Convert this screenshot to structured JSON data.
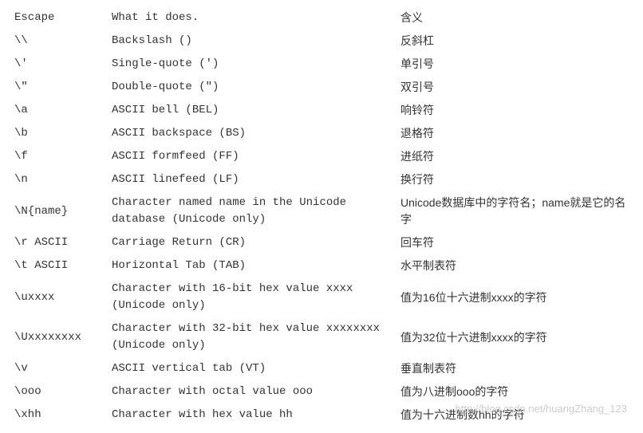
{
  "header": {
    "escape": "Escape",
    "desc": "What it does.",
    "cn": "含义"
  },
  "rows": [
    {
      "escape": "\\\\",
      "desc": "Backslash ()",
      "cn": "反斜杠"
    },
    {
      "escape": "\\'",
      "desc": "Single-quote (')",
      "cn": "单引号"
    },
    {
      "escape": "\\\"",
      "desc": "Double-quote (\")",
      "cn": "双引号"
    },
    {
      "escape": "\\a",
      "desc": "ASCII bell (BEL)",
      "cn": "响铃符"
    },
    {
      "escape": "\\b",
      "desc": "ASCII backspace (BS)",
      "cn": "退格符"
    },
    {
      "escape": "\\f",
      "desc": "ASCII formfeed (FF)",
      "cn": "进纸符"
    },
    {
      "escape": "\\n",
      "desc": "ASCII linefeed (LF)",
      "cn": "换行符"
    },
    {
      "escape": "\\N{name}",
      "desc": "Character named name in the Unicode database (Unicode only)",
      "cn": "Unicode数据库中的字符名；name就是它的名字"
    },
    {
      "escape": "\\r ASCII",
      "desc": "Carriage Return (CR)",
      "cn": "回车符"
    },
    {
      "escape": "\\t ASCII",
      "desc": "Horizontal Tab (TAB)",
      "cn": "水平制表符"
    },
    {
      "escape": "\\uxxxx",
      "desc": "Character with 16-bit hex value xxxx (Unicode only)",
      "cn": "值为16位十六进制xxxx的字符"
    },
    {
      "escape": "\\Uxxxxxxxx",
      "desc": "Character with 32-bit hex value xxxxxxxx (Unicode only)",
      "cn": "值为32位十六进制xxxx的字符"
    },
    {
      "escape": "\\v",
      "desc": "ASCII vertical tab (VT)",
      "cn": "垂直制表符"
    },
    {
      "escape": "\\ooo",
      "desc": "Character with octal value ooo",
      "cn": "值为八进制ooo的字符"
    },
    {
      "escape": "\\xhh",
      "desc": "Character with hex value hh",
      "cn": "值为十六进制数hh的字符"
    }
  ],
  "watermark": "http://blog.csdn.net/huangZhang_123"
}
